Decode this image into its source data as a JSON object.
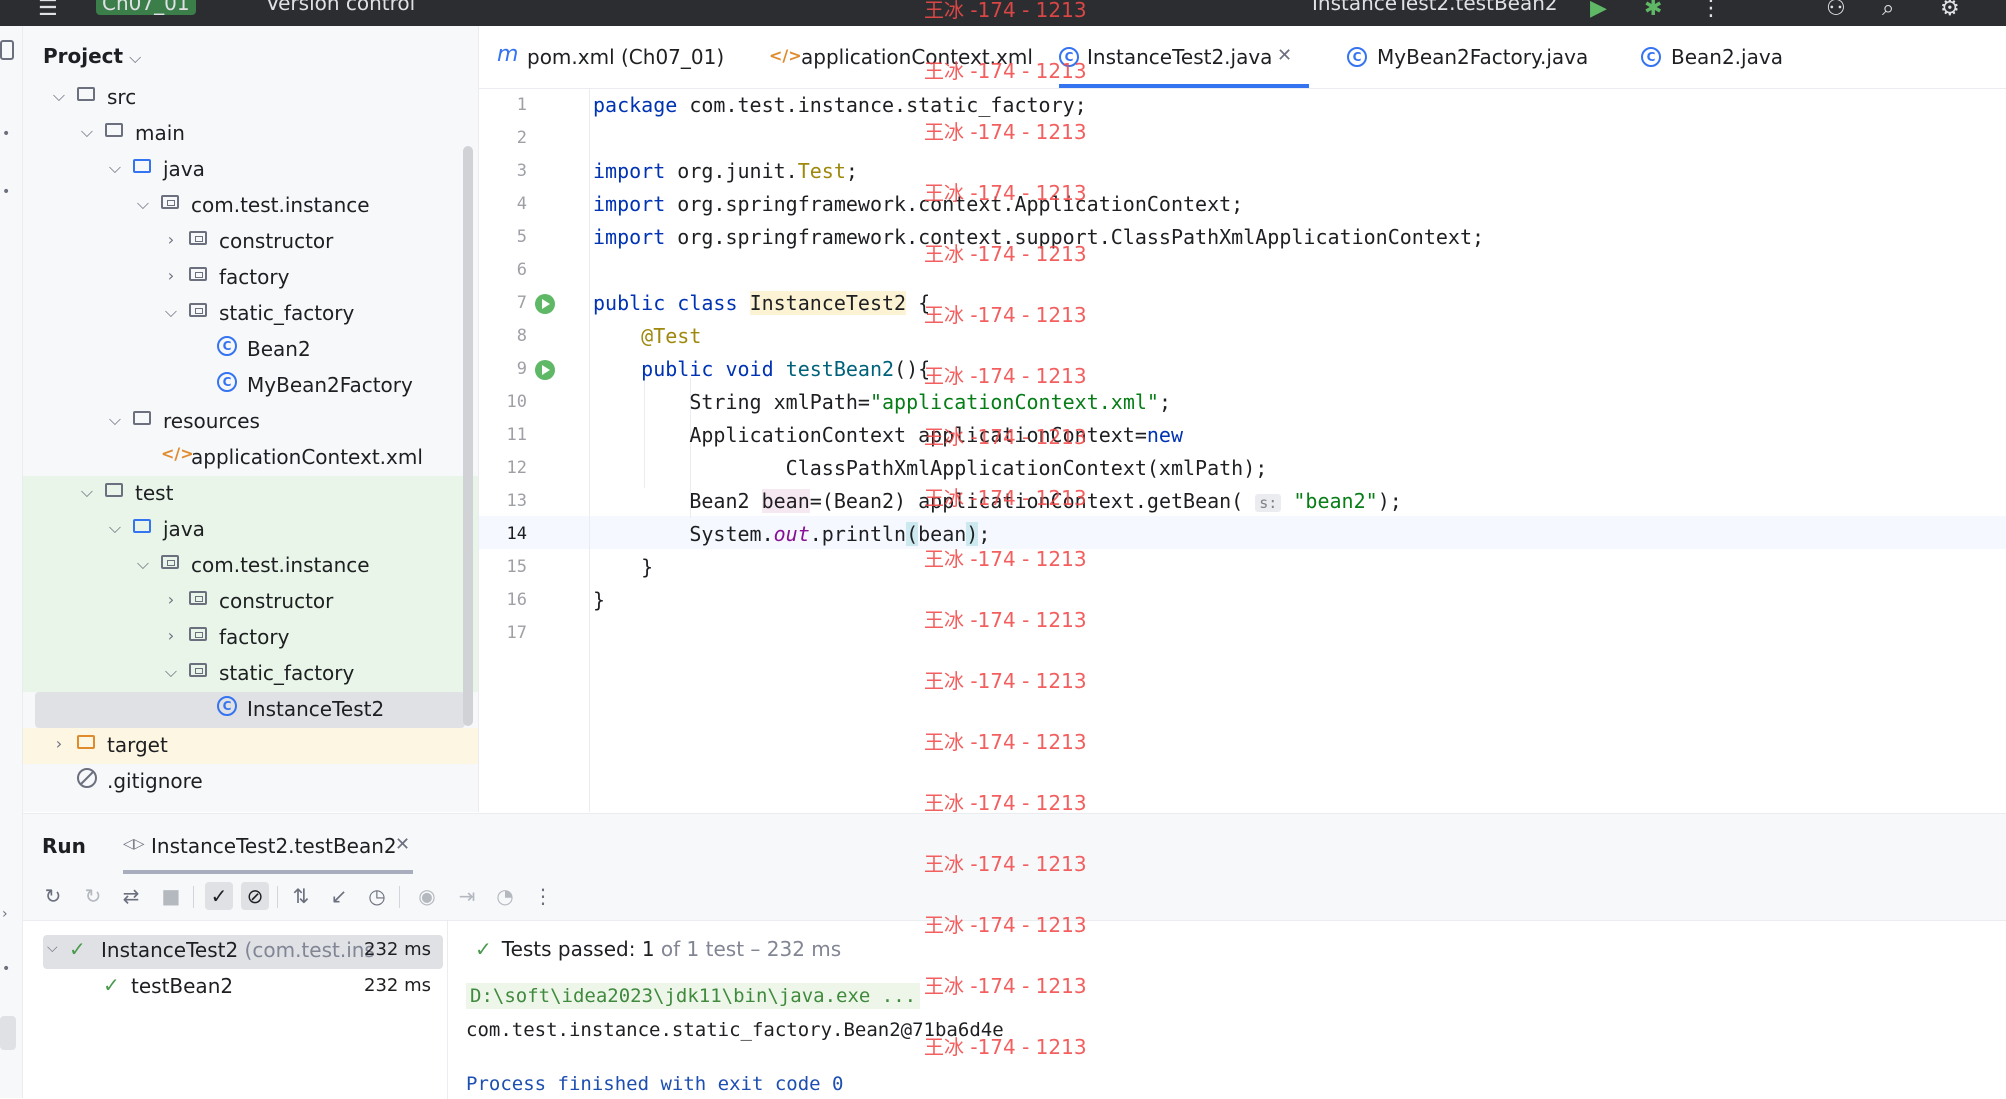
{
  "titlebar": {
    "project_badge": "Ch07_01",
    "vcs": "Version control",
    "run_config": "InstanceTest2.testBean2"
  },
  "project": {
    "title": "Project",
    "tree": [
      {
        "label": "src",
        "kind": "folder"
      },
      {
        "label": "main",
        "kind": "folder"
      },
      {
        "label": "java",
        "kind": "folder-blue"
      },
      {
        "label": "com.test.instance",
        "kind": "package"
      },
      {
        "label": "constructor",
        "kind": "package"
      },
      {
        "label": "factory",
        "kind": "package"
      },
      {
        "label": "static_factory",
        "kind": "package"
      },
      {
        "label": "Bean2",
        "kind": "class"
      },
      {
        "label": "MyBean2Factory",
        "kind": "class"
      },
      {
        "label": "resources",
        "kind": "resources"
      },
      {
        "label": "applicationContext.xml",
        "kind": "xml"
      },
      {
        "label": "test",
        "kind": "folder"
      },
      {
        "label": "java",
        "kind": "folder-blue"
      },
      {
        "label": "com.test.instance",
        "kind": "package"
      },
      {
        "label": "constructor",
        "kind": "package"
      },
      {
        "label": "factory",
        "kind": "package"
      },
      {
        "label": "static_factory",
        "kind": "package"
      },
      {
        "label": "InstanceTest2",
        "kind": "class"
      },
      {
        "label": "target",
        "kind": "folder-orange"
      },
      {
        "label": ".gitignore",
        "kind": "ignore"
      }
    ]
  },
  "tabs": [
    {
      "label": "pom.xml (Ch07_01)",
      "icon": "maven-icon"
    },
    {
      "label": "applicationContext.xml",
      "icon": "xml-icon"
    },
    {
      "label": "InstanceTest2.java",
      "icon": "class-icon",
      "active": true
    },
    {
      "label": "MyBean2Factory.java",
      "icon": "class-icon"
    },
    {
      "label": "Bean2.java",
      "icon": "class-icon"
    }
  ],
  "editor": {
    "line_numbers": [
      "1",
      "2",
      "3",
      "4",
      "5",
      "6",
      "7",
      "8",
      "9",
      "10",
      "11",
      "12",
      "13",
      "14",
      "15",
      "16",
      "17"
    ],
    "current_line": "14",
    "code": {
      "l1_kw": "package",
      "l1_rest": " com.test.instance.static_factory;",
      "l3_kw": "import",
      "l3_a": " org.junit.",
      "l3_b": "Test",
      "l3_c": ";",
      "l4_kw": "import",
      "l4_rest": " org.springframework.context.ApplicationContext;",
      "l5_kw": "import",
      "l5_rest": " org.springframework.context.support.ClassPathXmlApplicationContext;",
      "l7_kw1": "public",
      "l7_kw2": "class",
      "l7_cls": "InstanceTest2",
      "l7_brace": " {",
      "l8_ann": "@Test",
      "l9_kw1": "public",
      "l9_kw2": "void",
      "l9_name": "testBean2",
      "l9_rest": "(){",
      "l10_a": "String xmlPath=",
      "l10_str": "\"applicationContext.xml\"",
      "l10_b": ";",
      "l11_a": "ApplicationContext applicationContext=",
      "l11_kw": "new",
      "l12": "ClassPathXmlApplicationContext(xmlPath);",
      "l13_a": "Bean2 ",
      "l13_var": "bean",
      "l13_b": "=(Bean2) applicationContext.getBean( ",
      "l13_hint": "s:",
      "l13_str": "\"bean2\"",
      "l13_c": ");",
      "l14_a": "System.",
      "l14_fld": "out",
      "l14_b": ".println",
      "l14_open": "(",
      "l14_arg": "bean",
      "l14_close": ")",
      "l14_c": ";",
      "l15": "}",
      "l16": "}"
    }
  },
  "run": {
    "title": "Run",
    "tab_label": "InstanceTest2.testBean2",
    "tests": {
      "root_name": "InstanceTest2",
      "root_pkg": "(com.test.ins",
      "root_duration": "232 ms",
      "child_name": "testBean2",
      "child_duration": "232 ms"
    },
    "status_prefix": "Tests passed: ",
    "status_count": "1",
    "status_rest": "of 1 test – 232 ms",
    "console": [
      "D:\\soft\\idea2023\\jdk11\\bin\\java.exe ...",
      "com.test.instance.static_factory.Bean2@71ba6d4e",
      "Process finished with exit code 0"
    ]
  },
  "watermark": "王冰 -174 - 1213"
}
